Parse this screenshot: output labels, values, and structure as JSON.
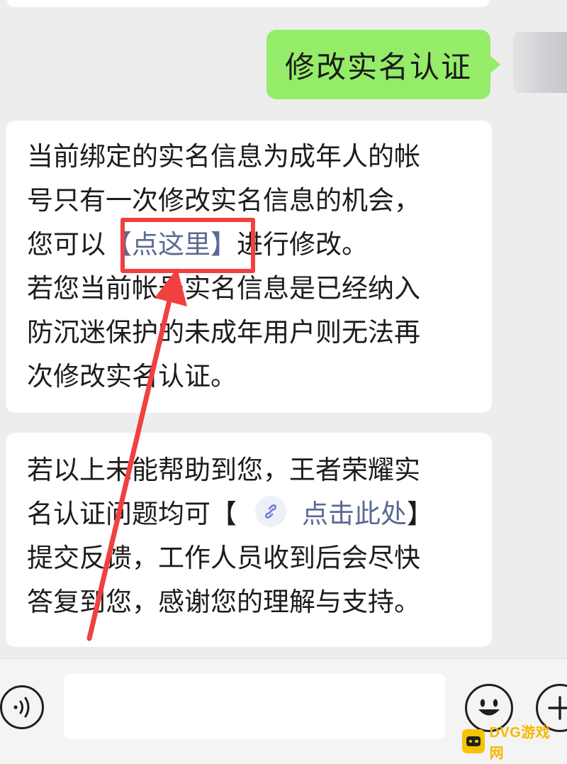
{
  "chat": {
    "outgoing_text": "修改实名认证",
    "reply_1_lines": [
      "当前绑定的实名信息为成年人的帐",
      "号只有一次修改实名信息的机会，",
      "您可以",
      "【点这里】",
      "进行修改。",
      "若您当前帐号实名信息是已经纳入",
      "防沉迷保护的未成年用户则无法再",
      "次修改实名认证。"
    ],
    "reply_2_lines": [
      "若以上未能帮助到您，王者荣耀实",
      "名认证问题均可【",
      "点击此处",
      "】",
      "提交反馈，工作人员收到后会尽快",
      "答复到您，感谢您的理解与支持。"
    ]
  },
  "input": {
    "value": ""
  },
  "colors": {
    "outgoing_bubble": "#95ec69",
    "highlight": "#f0403f",
    "link": "#5b6a92",
    "background": "#ededed"
  },
  "icons": {
    "voice": "voice-icon",
    "emoji": "emoji-icon",
    "plus": "plus-icon",
    "link": "link-icon"
  },
  "watermark": {
    "text": "DVG游戏网"
  }
}
